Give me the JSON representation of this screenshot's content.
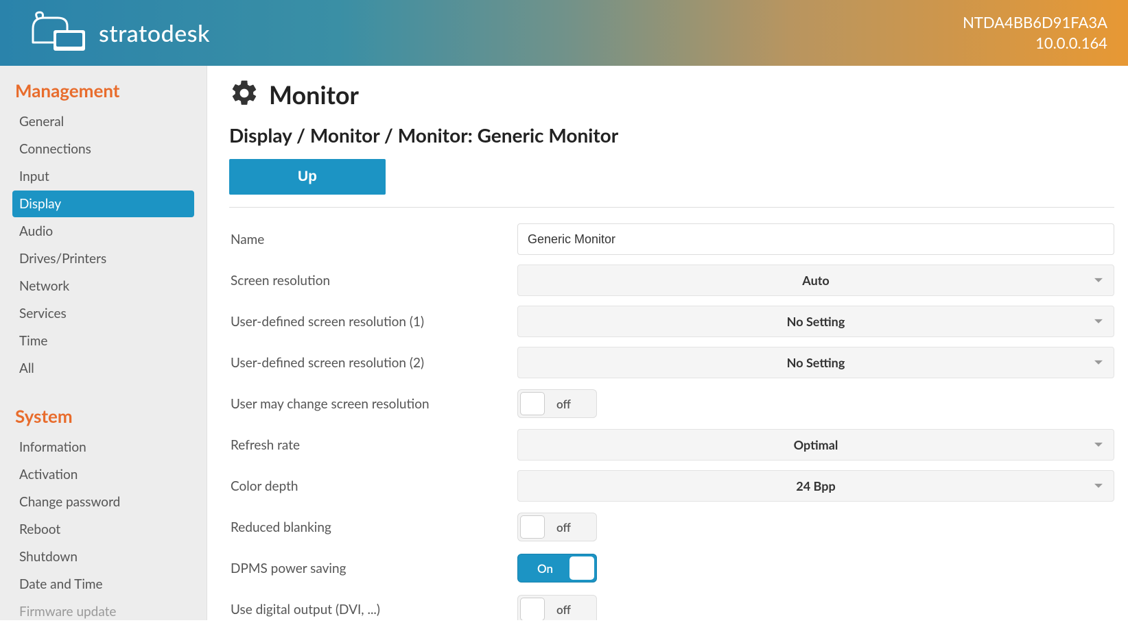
{
  "header": {
    "brand_name": "stratodesk",
    "hostname": "NTDA4BB6D91FA3A",
    "ip": "10.0.0.164"
  },
  "sidebar": {
    "section1_title": "Management",
    "section2_title": "System",
    "items1": [
      {
        "label": "General",
        "active": false
      },
      {
        "label": "Connections",
        "active": false
      },
      {
        "label": "Input",
        "active": false
      },
      {
        "label": "Display",
        "active": true
      },
      {
        "label": "Audio",
        "active": false
      },
      {
        "label": "Drives/Printers",
        "active": false
      },
      {
        "label": "Network",
        "active": false
      },
      {
        "label": "Services",
        "active": false
      },
      {
        "label": "Time",
        "active": false
      },
      {
        "label": "All",
        "active": false
      }
    ],
    "items2": [
      {
        "label": "Information"
      },
      {
        "label": "Activation"
      },
      {
        "label": "Change password"
      },
      {
        "label": "Reboot"
      },
      {
        "label": "Shutdown"
      },
      {
        "label": "Date and Time"
      },
      {
        "label": "Firmware update"
      }
    ]
  },
  "main": {
    "page_title": "Monitor",
    "breadcrumb": "Display / Monitor / Monitor: Generic Monitor",
    "up_button": "Up",
    "fields": {
      "name": {
        "label": "Name",
        "value": "Generic Monitor"
      },
      "resolution": {
        "label": "Screen resolution",
        "value": "Auto"
      },
      "user_res1": {
        "label": "User-defined screen resolution (1)",
        "value": "No Setting"
      },
      "user_res2": {
        "label": "User-defined screen resolution (2)",
        "value": "No Setting"
      },
      "user_may_change": {
        "label": "User may change screen resolution",
        "value": "off",
        "state": "off"
      },
      "refresh": {
        "label": "Refresh rate",
        "value": "Optimal"
      },
      "color_depth": {
        "label": "Color depth",
        "value": "24 Bpp"
      },
      "reduced_blanking": {
        "label": "Reduced blanking",
        "value": "off",
        "state": "off"
      },
      "dpms": {
        "label": "DPMS power saving",
        "value": "On",
        "state": "on"
      },
      "digital_output": {
        "label": "Use digital output (DVI, ...)",
        "value": "off",
        "state": "off"
      }
    }
  }
}
